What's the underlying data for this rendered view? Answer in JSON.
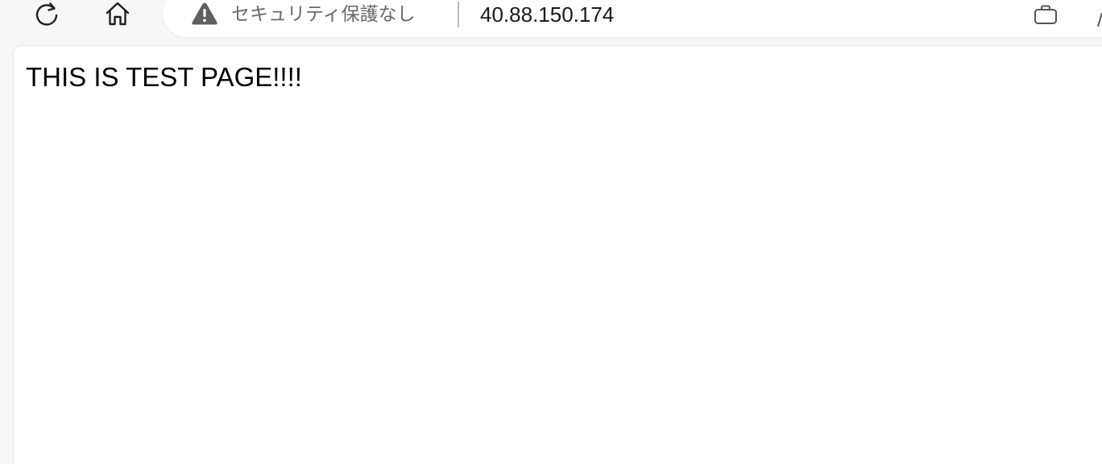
{
  "toolbar": {
    "reload_icon": "reload-icon",
    "home_icon": "home-icon"
  },
  "omnibox": {
    "security_icon": "warning-triangle-icon",
    "security_label": "セキュリティ保護なし",
    "url": "40.88.150.174",
    "extension_icon": "briefcase-icon"
  },
  "page": {
    "heading": "THIS IS TEST PAGE!!!!"
  },
  "colors": {
    "chrome_bg": "#f7f7f7",
    "omnibox_bg": "#ffffff",
    "security_text": "#6a6a6a",
    "url_text": "#1a1a1a"
  }
}
